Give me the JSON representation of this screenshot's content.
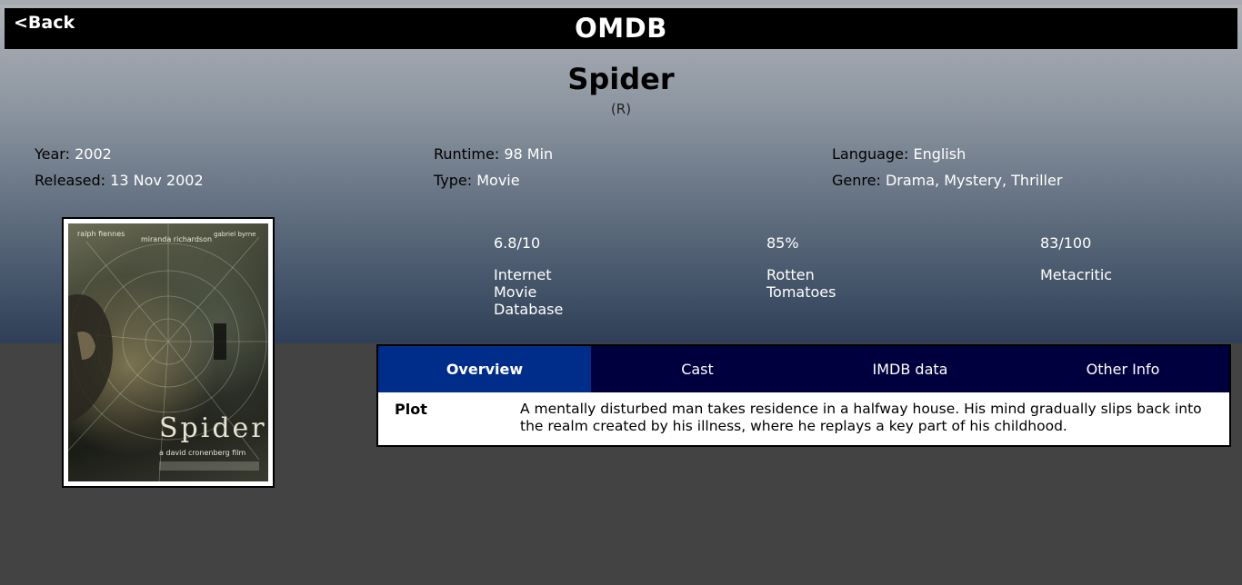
{
  "navbar": {
    "back_label": "<Back",
    "brand": "OMDB"
  },
  "movie": {
    "title": "Spider",
    "rated": "(R)"
  },
  "details": {
    "year": {
      "label": "Year:",
      "value": "2002"
    },
    "released": {
      "label": "Released:",
      "value": "13 Nov 2002"
    },
    "runtime": {
      "label": "Runtime:",
      "value": "98 Min"
    },
    "type": {
      "label": "Type:",
      "value": "Movie"
    },
    "language": {
      "label": "Language:",
      "value": "English"
    },
    "genre": {
      "label": "Genre:",
      "value": "Drama, Mystery, Thriller"
    }
  },
  "poster": {
    "cast_names": [
      "ralph fiennes",
      "miranda richardson",
      "gabriel byrne"
    ],
    "title_text": "Spider",
    "director_text": "a david cronenberg film"
  },
  "ratings": [
    {
      "value": "6.8/10",
      "source": "Internet Movie Database"
    },
    {
      "value": "85%",
      "source": "Rotten Tomatoes"
    },
    {
      "value": "83/100",
      "source": "Metacritic"
    }
  ],
  "tabs": [
    {
      "label": "Overview",
      "active": true
    },
    {
      "label": "Cast",
      "active": false
    },
    {
      "label": "IMDB data",
      "active": false
    },
    {
      "label": "Other Info",
      "active": false
    }
  ],
  "overview": {
    "plot_label": "Plot",
    "plot_text": "A mentally disturbed man takes residence in a halfway house. His mind gradually slips back into the realm created by his illness, where he replays a key part of his childhood."
  },
  "colors": {
    "navbar": "#000000",
    "tab_bar": "#00003f",
    "tab_active": "#002d89",
    "page_bg": "#434343"
  }
}
